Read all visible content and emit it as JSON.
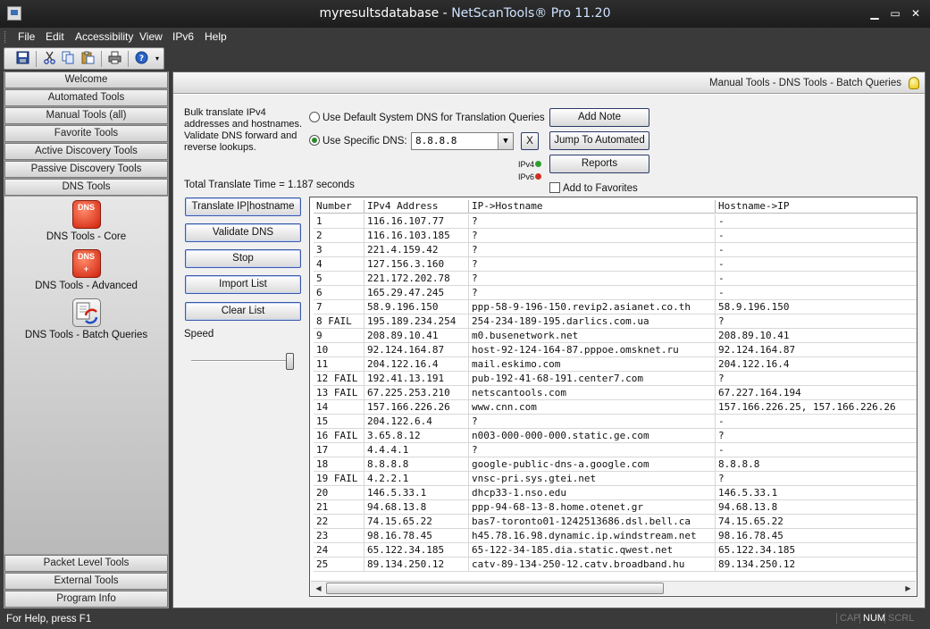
{
  "window": {
    "title_main": "myresultsdatabase",
    "title_sep": " - ",
    "title_app": "NetScanTools® Pro 11.20",
    "min": "▁",
    "max": "▭",
    "close": "✕"
  },
  "menu": [
    "File",
    "Edit",
    "Accessibility",
    "View",
    "IPv6",
    "Help"
  ],
  "toolbar": [
    "save-icon",
    "cut-icon",
    "copy-icon",
    "paste-icon",
    "print-icon",
    "help-icon"
  ],
  "nav": {
    "top": [
      "Welcome",
      "Automated Tools",
      "Manual Tools (all)",
      "Favorite Tools",
      "Active Discovery Tools",
      "Passive Discovery Tools",
      "DNS Tools"
    ],
    "tools": [
      "DNS Tools - Core",
      "DNS Tools - Advanced",
      "DNS Tools - Batch Queries"
    ],
    "bottom": [
      "Packet Level Tools",
      "External Tools",
      "Program Info"
    ],
    "dns_icon_text": "DNS"
  },
  "panel": {
    "breadcrumb": "Manual Tools - DNS Tools - Batch Queries",
    "description": "Bulk translate IPv4 addresses and hostnames. Validate DNS forward and reverse lookups.",
    "radio_default": "Use Default System DNS for Translation Queries",
    "radio_specific": "Use Specific DNS:",
    "dns_value": "8.8.8.8",
    "clear_x": "X",
    "add_note": "Add Note",
    "jump_auto": "Jump To Automated",
    "reports": "Reports",
    "ipv4": "IPv4",
    "ipv6": "IPv6",
    "add_favorites": "Add to Favorites",
    "total_time": "Total Translate Time = 1.187 seconds",
    "buttons": [
      "Translate IP|hostname",
      "Validate DNS",
      "Stop",
      "Import List",
      "Clear List"
    ],
    "speed": "Speed",
    "speed_level": 1.0
  },
  "table": {
    "headers": [
      "Number",
      "IPv4 Address",
      "IP->Hostname",
      "Hostname->IP"
    ],
    "rows": [
      [
        "1",
        "116.16.107.77",
        "?",
        "-"
      ],
      [
        "2",
        "116.16.103.185",
        "?",
        "-"
      ],
      [
        "3",
        "221.4.159.42",
        "?",
        "-"
      ],
      [
        "4",
        "127.156.3.160",
        "?",
        "-"
      ],
      [
        "5",
        "221.172.202.78",
        "?",
        "-"
      ],
      [
        "6",
        "165.29.47.245",
        "?",
        "-"
      ],
      [
        "7",
        "58.9.196.150",
        "ppp-58-9-196-150.revip2.asianet.co.th",
        "58.9.196.150"
      ],
      [
        "8 FAIL",
        "195.189.234.254",
        "254-234-189-195.darlics.com.ua",
        "?"
      ],
      [
        "9",
        "208.89.10.41",
        "m0.busenetwork.net",
        "208.89.10.41"
      ],
      [
        "10",
        "92.124.164.87",
        "host-92-124-164-87.pppoe.omsknet.ru",
        "92.124.164.87"
      ],
      [
        "11",
        "204.122.16.4",
        "mail.eskimo.com",
        "204.122.16.4"
      ],
      [
        "12 FAIL",
        "192.41.13.191",
        "pub-192-41-68-191.center7.com",
        "?"
      ],
      [
        "13 FAIL",
        "67.225.253.210",
        "netscantools.com",
        "67.227.164.194"
      ],
      [
        "14",
        "157.166.226.26",
        "www.cnn.com",
        "157.166.226.25, 157.166.226.26"
      ],
      [
        "15",
        "204.122.6.4",
        "?",
        "-"
      ],
      [
        "16 FAIL",
        "3.65.8.12",
        "n003-000-000-000.static.ge.com",
        "?"
      ],
      [
        "17",
        "4.4.4.1",
        "?",
        "-"
      ],
      [
        "18",
        "8.8.8.8",
        "google-public-dns-a.google.com",
        "8.8.8.8"
      ],
      [
        "19 FAIL",
        "4.2.2.1",
        "vnsc-pri.sys.gtei.net",
        "?"
      ],
      [
        "20",
        "146.5.33.1",
        "dhcp33-1.nso.edu",
        "146.5.33.1"
      ],
      [
        "21",
        "94.68.13.8",
        "ppp-94-68-13-8.home.otenet.gr",
        "94.68.13.8"
      ],
      [
        "22",
        "74.15.65.22",
        "bas7-toronto01-1242513686.dsl.bell.ca",
        "74.15.65.22"
      ],
      [
        "23",
        "98.16.78.45",
        "h45.78.16.98.dynamic.ip.windstream.net",
        "98.16.78.45"
      ],
      [
        "24",
        "65.122.34.185",
        "65-122-34-185.dia.static.qwest.net",
        "65.122.34.185"
      ],
      [
        "25",
        "89.134.250.12",
        "catv-89-134-250-12.catv.broadband.hu",
        "89.134.250.12"
      ]
    ]
  },
  "status": {
    "help": "For Help, press F1",
    "cap": "CAP",
    "num": "NUM",
    "scrl": "SCRL"
  },
  "colors": {
    "ok": "#2ea02e",
    "fail": "#d03020"
  }
}
